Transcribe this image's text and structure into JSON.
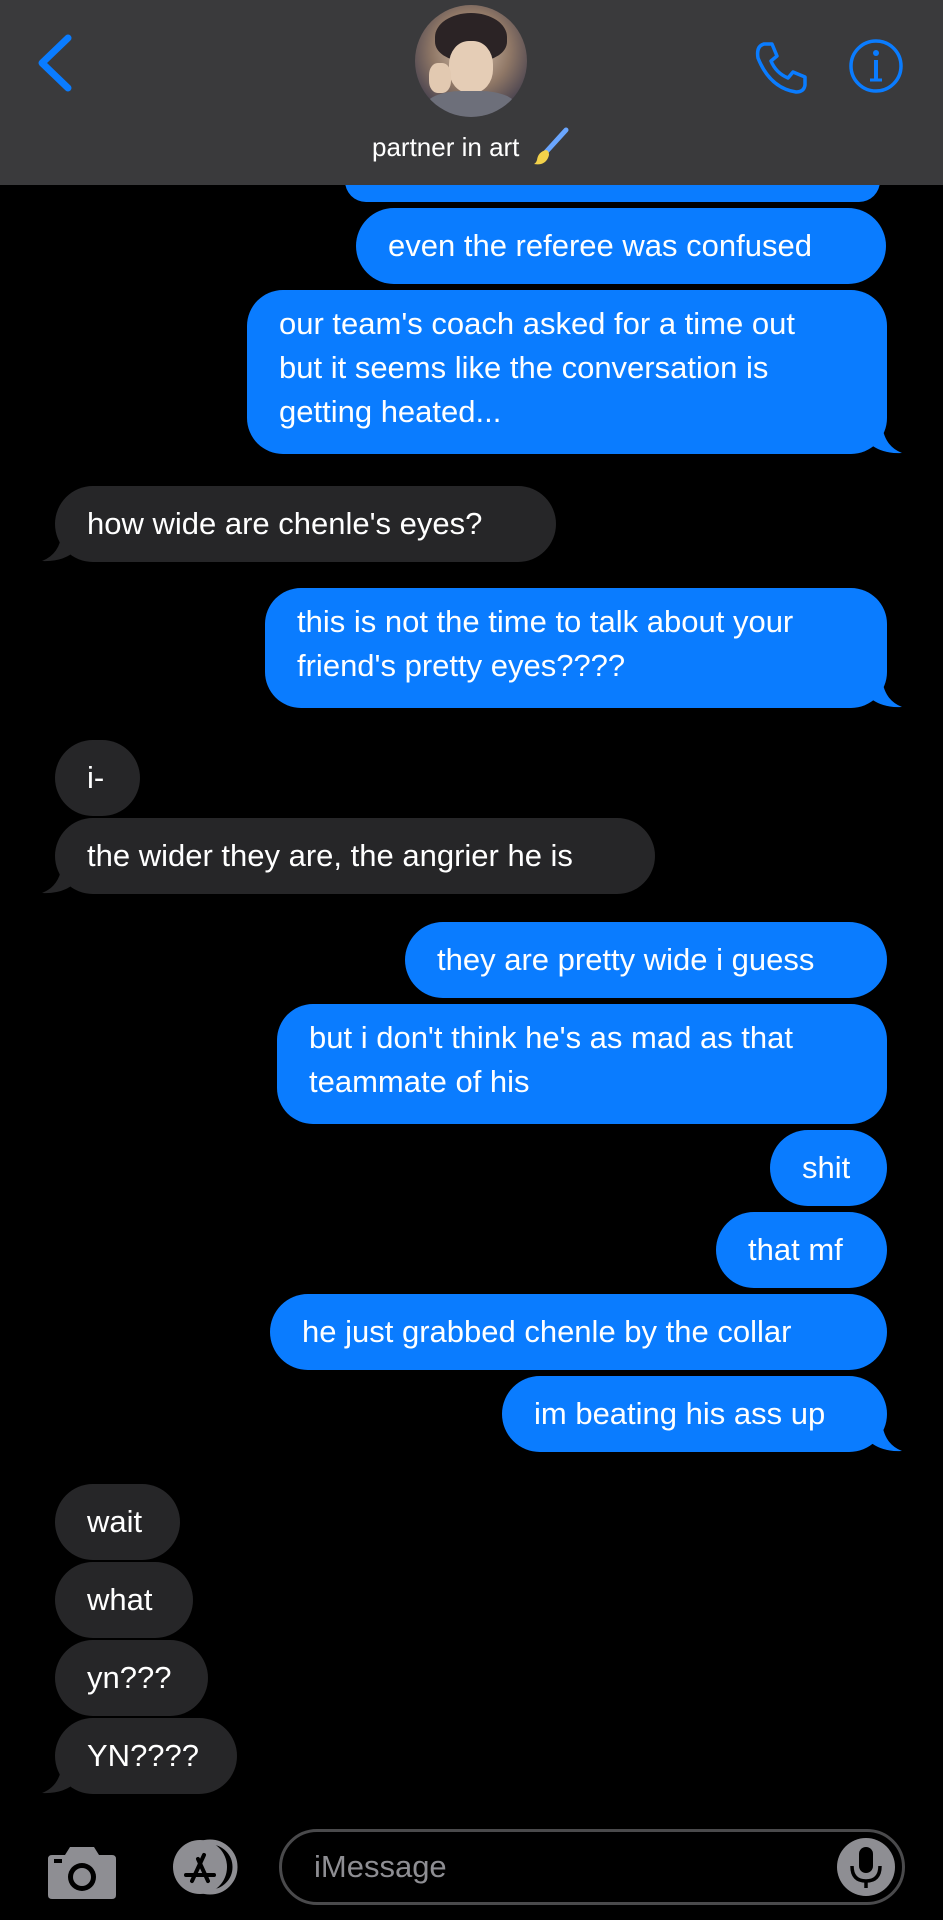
{
  "header": {
    "contact_name": "partner in art",
    "icons": [
      "back-icon",
      "avatar",
      "paintbrush-icon",
      "phone-icon",
      "info-icon"
    ],
    "accent_color": "#0a7cff"
  },
  "messages": [
    {
      "sender": "me",
      "text": ""
    },
    {
      "sender": "me",
      "text": "even the referee was confused"
    },
    {
      "sender": "me",
      "text": "our team's coach asked for a time out\nbut it seems like the conversation is\ngetting heated..."
    },
    {
      "sender": "them",
      "text": "how wide are chenle's eyes?"
    },
    {
      "sender": "me",
      "text": "this is not the time to talk about your\nfriend's pretty eyes????"
    },
    {
      "sender": "them",
      "text": "i-"
    },
    {
      "sender": "them",
      "text": "the wider they are, the angrier he is"
    },
    {
      "sender": "me",
      "text": "they are pretty wide i guess"
    },
    {
      "sender": "me",
      "text": "but i don't think he's as mad as that\nteammate of his"
    },
    {
      "sender": "me",
      "text": "shit"
    },
    {
      "sender": "me",
      "text": "that mf"
    },
    {
      "sender": "me",
      "text": "he just grabbed chenle by the collar"
    },
    {
      "sender": "me",
      "text": "im beating his ass up"
    },
    {
      "sender": "them",
      "text": "wait"
    },
    {
      "sender": "them",
      "text": "what"
    },
    {
      "sender": "them",
      "text": "yn???"
    },
    {
      "sender": "them",
      "text": "YN????"
    }
  ],
  "composer": {
    "placeholder": "iMessage",
    "icons": [
      "camera-icon",
      "app-store-icon",
      "microphone-icon"
    ]
  },
  "colors": {
    "sent_bubble": "#0a7cff",
    "received_bubble": "#262628",
    "header_bg": "#3a3a3c",
    "background": "#000000"
  }
}
